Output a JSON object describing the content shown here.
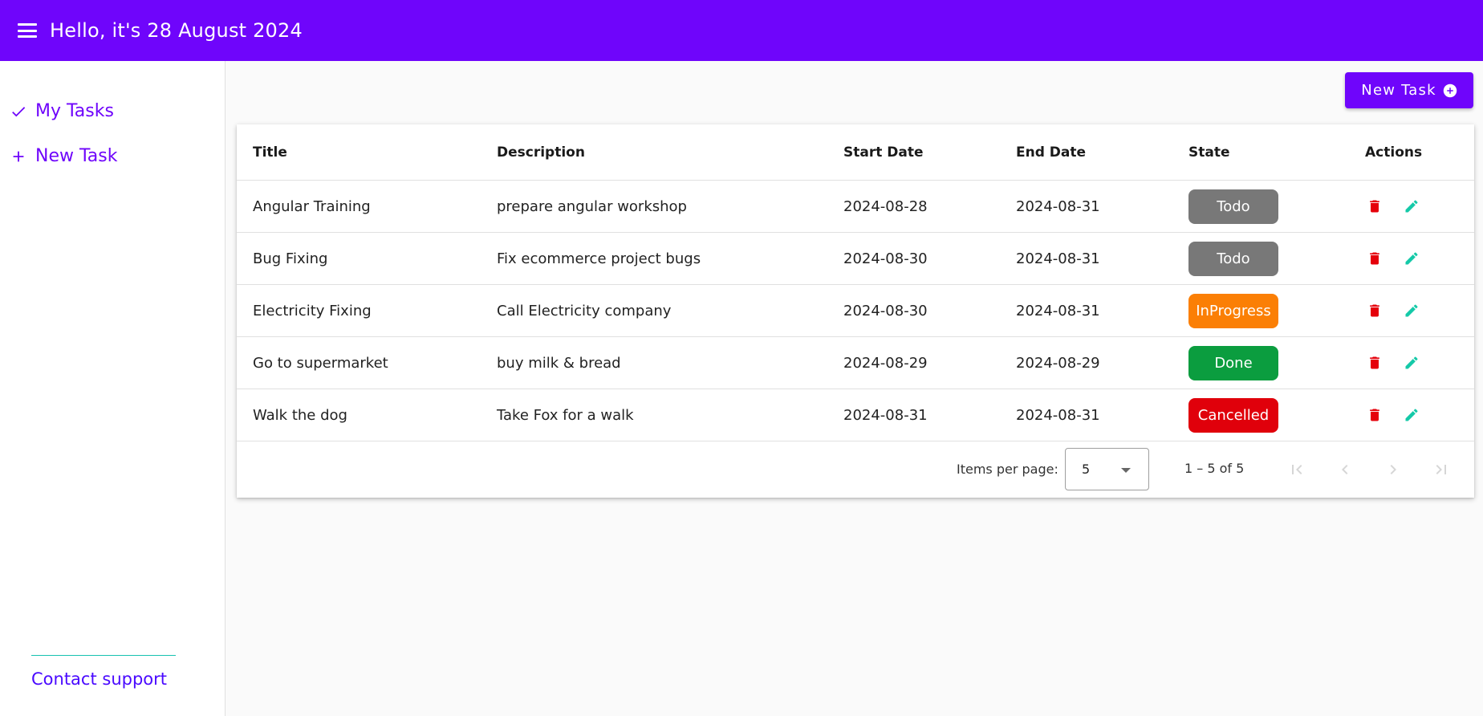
{
  "header": {
    "title": "Hello, it's 28 August 2024",
    "menu_icon": "menu-icon"
  },
  "sidebar": {
    "items": [
      {
        "label": "My Tasks",
        "icon": "check-icon"
      },
      {
        "label": "New Task",
        "icon": "plus-icon"
      }
    ],
    "support_link": "Contact support"
  },
  "toolbar": {
    "new_task_label": "New Task",
    "new_task_icon": "add-circle-icon"
  },
  "table": {
    "columns": [
      "Title",
      "Description",
      "Start Date",
      "End Date",
      "State",
      "Actions"
    ],
    "rows": [
      {
        "title": "Angular Training",
        "description": "prepare angular workshop",
        "start": "2024-08-28",
        "end": "2024-08-31",
        "state": "Todo"
      },
      {
        "title": "Bug Fixing",
        "description": "Fix ecommerce project bugs",
        "start": "2024-08-30",
        "end": "2024-08-31",
        "state": "Todo"
      },
      {
        "title": "Electricity Fixing",
        "description": "Call Electricity company",
        "start": "2024-08-30",
        "end": "2024-08-31",
        "state": "InProgress"
      },
      {
        "title": "Go to supermarket",
        "description": "buy milk & bread",
        "start": "2024-08-29",
        "end": "2024-08-29",
        "state": "Done"
      },
      {
        "title": "Walk the dog",
        "description": "Take Fox for a walk",
        "start": "2024-08-31",
        "end": "2024-08-31",
        "state": "Cancelled"
      }
    ],
    "actions": [
      "delete-icon",
      "edit-icon"
    ]
  },
  "state_colors": {
    "Todo": "#787878",
    "InProgress": "#fb7f05",
    "Done": "#0b9d3f",
    "Cancelled": "#e0000b"
  },
  "colors": {
    "primary": "#6f05fb",
    "delete": "#e5000b",
    "edit": "#14c9a8",
    "support_divider": "#17c2b0"
  },
  "paginator": {
    "items_per_page_label": "Items per page:",
    "page_size": "5",
    "range_label": "1 – 5 of 5"
  }
}
